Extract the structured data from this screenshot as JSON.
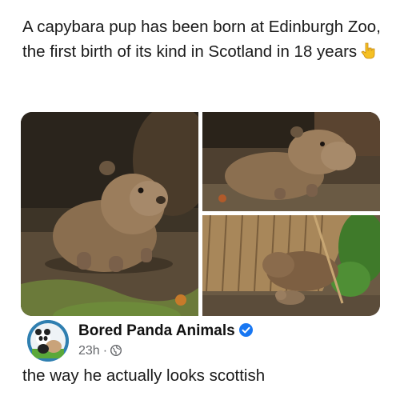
{
  "post": {
    "text": "A capybara pup has been born at Edinburgh Zoo, the first birth of its kind in Scotland in 18 years",
    "emoji": "pointing-down-icon"
  },
  "author": {
    "name": "Bored Panda Animals",
    "time": "23h",
    "separator": "·",
    "verified_icon": "verified-badge-icon",
    "audience_icon": "globe-icon"
  },
  "caption": "the way he actually looks scottish",
  "colors": {
    "verified": "#1877f2",
    "meta": "#65676b",
    "avatar_ring": "#2f7fb0"
  }
}
